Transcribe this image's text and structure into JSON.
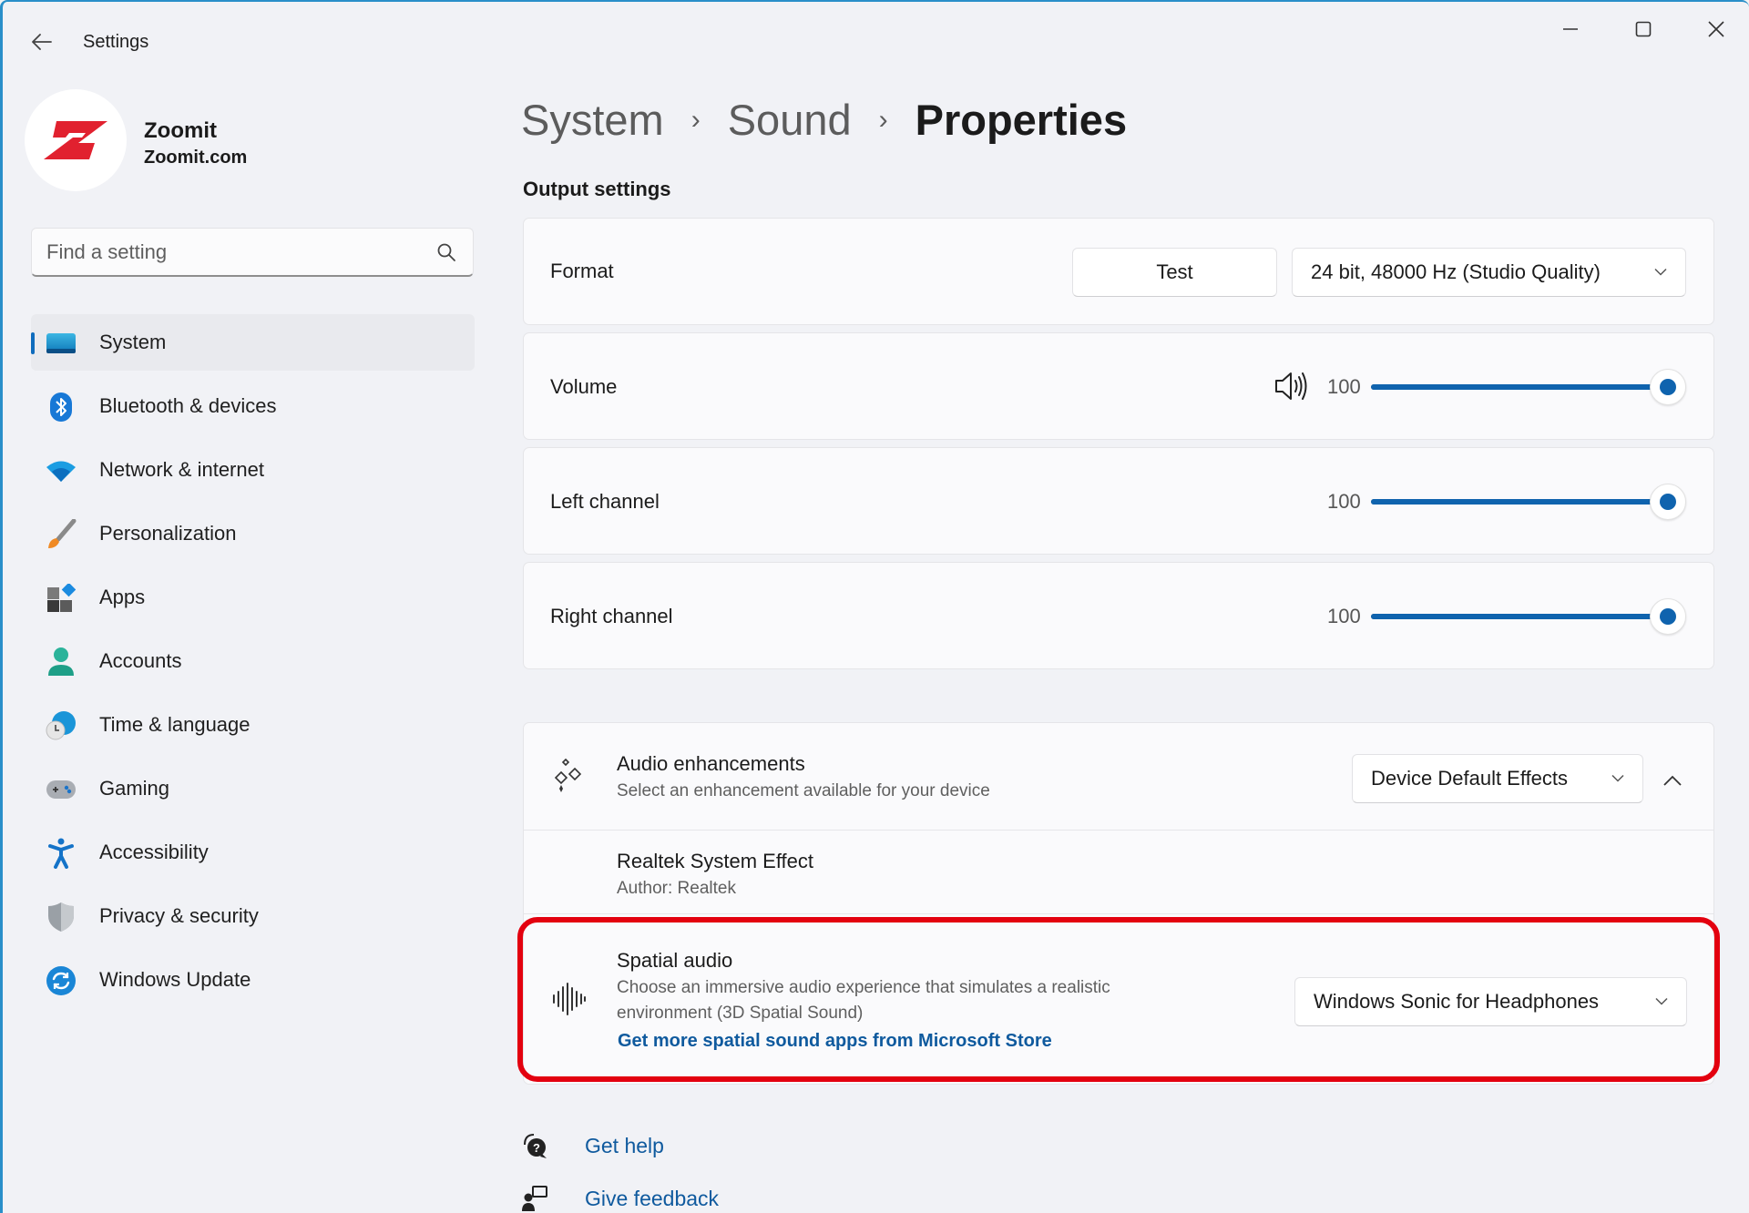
{
  "window": {
    "title": "Settings",
    "controls": {
      "minimize": "minimize",
      "maximize": "maximize",
      "close": "close"
    }
  },
  "profile": {
    "name": "Zoomit",
    "subtitle": "Zoomit.com",
    "logo_color": "#e1212f"
  },
  "search": {
    "placeholder": "Find a setting",
    "value": ""
  },
  "sidebar": {
    "items": [
      {
        "label": "System",
        "icon": "system-icon",
        "active": true
      },
      {
        "label": "Bluetooth & devices",
        "icon": "bluetooth-icon",
        "active": false
      },
      {
        "label": "Network & internet",
        "icon": "wifi-icon",
        "active": false
      },
      {
        "label": "Personalization",
        "icon": "paintbrush-icon",
        "active": false
      },
      {
        "label": "Apps",
        "icon": "apps-icon",
        "active": false
      },
      {
        "label": "Accounts",
        "icon": "account-icon",
        "active": false
      },
      {
        "label": "Time & language",
        "icon": "time-language-icon",
        "active": false
      },
      {
        "label": "Gaming",
        "icon": "gamepad-icon",
        "active": false
      },
      {
        "label": "Accessibility",
        "icon": "accessibility-icon",
        "active": false
      },
      {
        "label": "Privacy & security",
        "icon": "shield-icon",
        "active": false
      },
      {
        "label": "Windows Update",
        "icon": "update-icon",
        "active": false
      }
    ]
  },
  "breadcrumb": {
    "items": [
      "System",
      "Sound",
      "Properties"
    ],
    "separator": "›"
  },
  "output_settings": {
    "section_title": "Output settings",
    "format": {
      "label": "Format",
      "test_button": "Test",
      "selected": "24 bit, 48000 Hz (Studio Quality)"
    },
    "volume": {
      "label": "Volume",
      "value": 100,
      "display": "100",
      "max": 100
    },
    "left_channel": {
      "label": "Left channel",
      "value": 100,
      "display": "100",
      "max": 100
    },
    "right_channel": {
      "label": "Right channel",
      "value": 100,
      "display": "100",
      "max": 100
    }
  },
  "audio_enhancements": {
    "title": "Audio enhancements",
    "description": "Select an enhancement available for your device",
    "selected": "Device Default Effects",
    "expanded": true,
    "effect": {
      "name": "Realtek System Effect",
      "author": "Author: Realtek"
    }
  },
  "spatial_audio": {
    "title": "Spatial audio",
    "description_line1": "Choose an immersive audio experience that simulates a realistic",
    "description_line2": "environment (3D Spatial Sound)",
    "store_link": "Get more spatial sound apps from Microsoft Store",
    "selected": "Windows Sonic for Headphones",
    "highlighted": true,
    "highlight_color": "#e3000f"
  },
  "footer": {
    "get_help": "Get help",
    "give_feedback": "Give feedback"
  },
  "colors": {
    "accent": "#0f63ae",
    "link": "#0f5a9e",
    "window_bg": "#f1f2f6",
    "card_bg": "#fafafc"
  }
}
